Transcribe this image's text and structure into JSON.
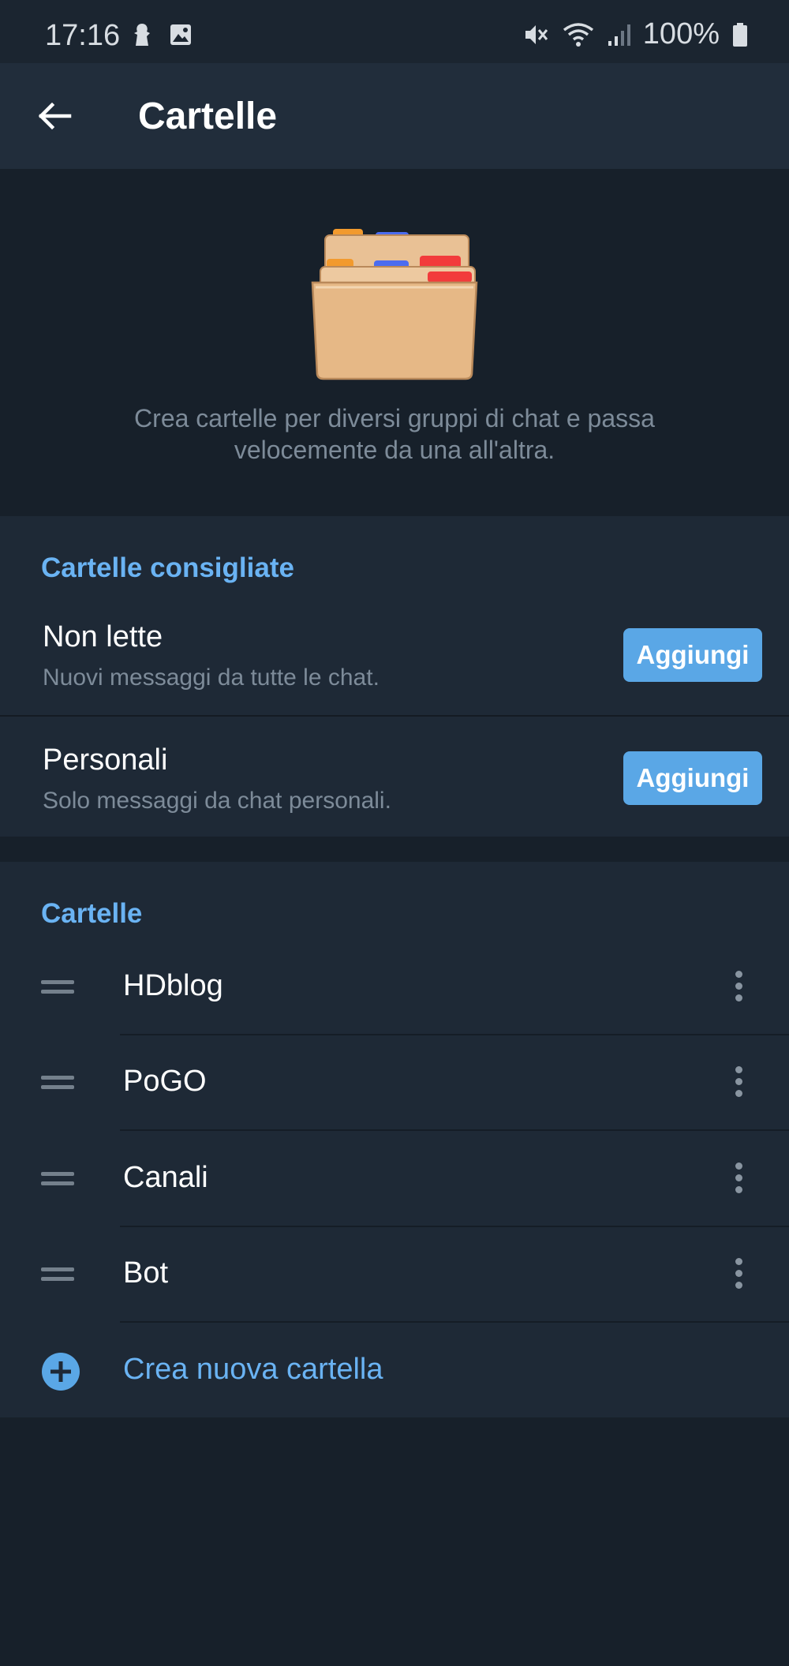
{
  "status_bar": {
    "time": "17:16",
    "battery_percent": "100%",
    "icons": [
      "silhouette-icon",
      "image-icon",
      "mute-icon",
      "wifi-icon",
      "signal-icon",
      "battery-icon"
    ]
  },
  "app_bar": {
    "title": "Cartelle",
    "back_icon": "arrow-left-icon"
  },
  "hero": {
    "illustration": "folders-illustration",
    "description_line1": "Crea cartelle per diversi gruppi di chat e passa",
    "description_line2": "velocemente da una all'altra."
  },
  "suggested": {
    "header": "Cartelle consigliate",
    "items": [
      {
        "name": "Non lette",
        "subtitle": "Nuovi messaggi da tutte le chat.",
        "button": "Aggiungi"
      },
      {
        "name": "Personali",
        "subtitle": "Solo messaggi da chat personali.",
        "button": "Aggiungi"
      }
    ]
  },
  "folders": {
    "header": "Cartelle",
    "items": [
      {
        "name": "HDblog"
      },
      {
        "name": "PoGO"
      },
      {
        "name": "Canali"
      },
      {
        "name": "Bot"
      }
    ],
    "create_label": "Crea nuova cartella"
  },
  "colors": {
    "background": "#17202a",
    "section": "#1e2936",
    "app_bar": "#212d3b",
    "accent": "#6ab3f3",
    "button": "#5aa7e6",
    "secondary_text": "#7d8b99"
  }
}
